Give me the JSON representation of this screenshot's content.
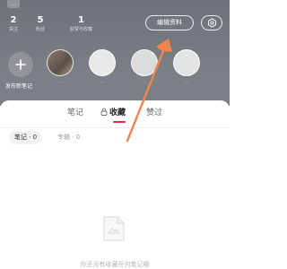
{
  "header": {
    "badge": "…",
    "stats": [
      {
        "num": "2",
        "label": "关注"
      },
      {
        "num": "5",
        "label": "粉丝"
      },
      {
        "num": "1",
        "label": "获赞与收藏"
      }
    ],
    "edit_profile_label": "编辑资料",
    "settings_icon": "gear-icon",
    "add_label": "发布新笔记",
    "stories": [
      {
        "label": "…"
      },
      {
        "label": "…"
      },
      {
        "label": "…"
      },
      {
        "label": "…"
      }
    ]
  },
  "tabs": {
    "notes": "笔记",
    "collections": "收藏",
    "liked": "赞过",
    "lock_icon": "lock-icon"
  },
  "subtabs": {
    "notes": "笔记 · 0",
    "albums": "专辑 · 0"
  },
  "empty": {
    "message": "你还没有收藏任何笔记哦"
  },
  "colors": {
    "accent": "#ff2442",
    "annotation_arrow": "#f5844c"
  }
}
